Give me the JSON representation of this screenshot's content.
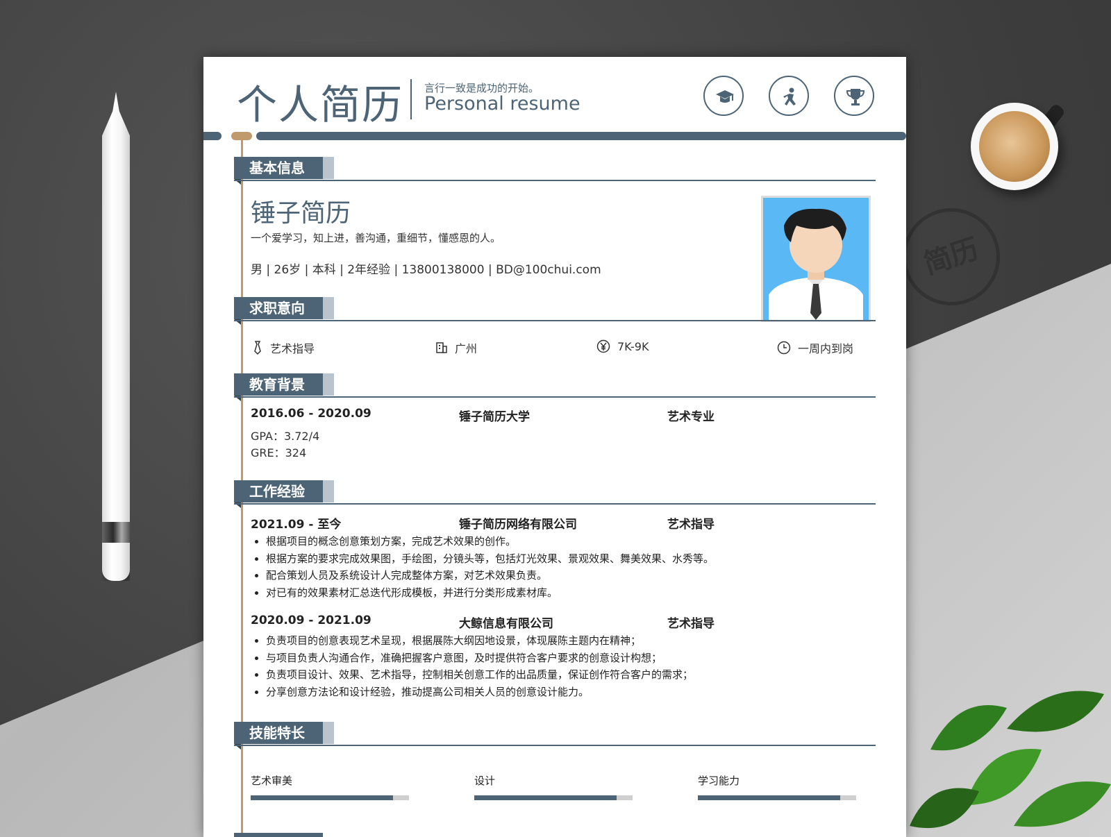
{
  "header": {
    "title": "个人简历",
    "tagline": "言行一致是成功的开始。",
    "subtitle_en": "Personal resume",
    "icons": [
      "graduation-cap-icon",
      "running-person-icon",
      "trophy-icon"
    ]
  },
  "sections": {
    "basic": "基本信息",
    "intent": "求职意向",
    "education": "教育背景",
    "work": "工作经验",
    "skills": "技能特长"
  },
  "basic": {
    "name": "锤子简历",
    "motto": "一个爱学习，知上进，善沟通，重细节，懂感恩的人。",
    "facts": "男 | 26岁 | 本科 | 2年经验 | 13800138000 | BD@100chui.com"
  },
  "intent": {
    "position": "艺术指导",
    "city": "广州",
    "salary": "7K-9K",
    "availability": "一周内到岗"
  },
  "education": {
    "period": "2016.06 - 2020.09",
    "school": "锤子简历大学",
    "major": "艺术专业",
    "gpa": "GPA：3.72/4",
    "gre": "GRE：324"
  },
  "work": [
    {
      "period": "2021.09 - 至今",
      "company": "锤子简历网络有限公司",
      "role": "艺术指导",
      "bullets": [
        "根据项目的概念创意策划方案，完成艺术效果的创作。",
        "根据方案的要求完成效果图，手绘图，分镜头等，包括灯光效果、景观效果、舞美效果、水秀等。",
        "配合策划人员及系统设计人完成整体方案，对艺术效果负责。",
        "对已有的效果素材汇总迭代形成模板，并进行分类形成素材库。"
      ]
    },
    {
      "period": "2020.09 - 2021.09",
      "company": "大鲸信息有限公司",
      "role": "艺术指导",
      "bullets": [
        "负责项目的创意表现艺术呈现，根据展陈大纲因地设景，体现展陈主题内在精神；",
        "与项目负责人沟通合作，准确把握客户意图，及时提供符合客户要求的创意设计构想；",
        "负责项目设计、效果、艺术指导，控制相关创意工作的出品质量，保证创作符合客户的需求；",
        "分享创意方法论和设计经验，推动提高公司相关人员的创意设计能力。"
      ]
    }
  ],
  "skills": [
    {
      "name": "艺术审美",
      "level": 0.9
    },
    {
      "name": "设计",
      "level": 0.9
    },
    {
      "name": "学习能力",
      "level": 0.9
    }
  ],
  "decor": {
    "stamp_text": "简历"
  },
  "colors": {
    "accent": "#4c6475",
    "gold": "#c09a6c",
    "photo_bg": "#5ab9f5"
  }
}
